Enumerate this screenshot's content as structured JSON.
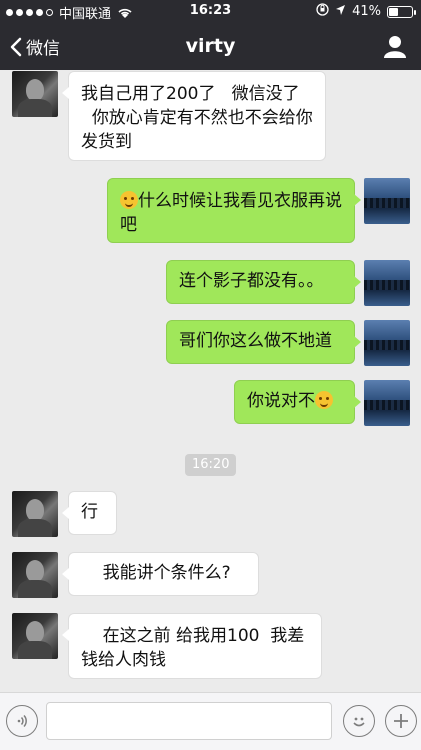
{
  "status_bar": {
    "carrier": "中国联通",
    "time": "16:23",
    "battery_text": "41%",
    "battery_level": 0.41
  },
  "nav": {
    "back_label": "微信",
    "title": "virty"
  },
  "messages": [
    {
      "side": "in",
      "text": "我自己用了200了   微信没了\n  你放心肯定有不然也不会给你发货到"
    },
    {
      "side": "out",
      "text": "什么时候让我看见衣服再说吧",
      "emoji_before": true
    },
    {
      "side": "out",
      "text": "连个影子都没有。。"
    },
    {
      "side": "out",
      "text": "哥们你这么做不地道"
    },
    {
      "side": "out",
      "text": "你说对不",
      "emoji_after": true
    },
    {
      "side": "in",
      "text": "行"
    },
    {
      "side": "in",
      "text": "    我能讲个条件么?"
    },
    {
      "side": "in",
      "text": "    在这之前 给我用100  我差钱给人肉钱"
    }
  ],
  "timestamp": "16:20",
  "icons": {
    "voice": "voice-icon",
    "emoji": "emoji-icon",
    "plus": "plus-icon",
    "profile": "profile-icon",
    "back": "chevron-left-icon"
  },
  "colors": {
    "nav_bg": "#2b2b30",
    "chat_bg": "#ebebeb",
    "outgoing_bubble": "#a0e75a",
    "incoming_bubble": "#ffffff"
  }
}
